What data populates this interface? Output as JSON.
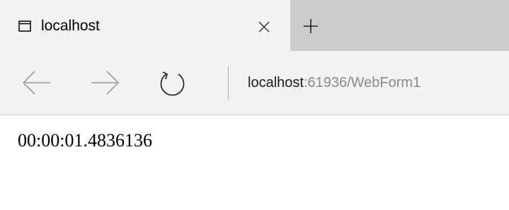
{
  "tab": {
    "icon": "page-icon",
    "title": "localhost",
    "close_icon": "close-icon"
  },
  "new_tab_icon": "plus-icon",
  "nav": {
    "back_icon": "back-arrow-icon",
    "forward_icon": "forward-arrow-icon",
    "refresh_icon": "refresh-icon"
  },
  "address": {
    "host": "localhost",
    "path": ":61936/WebForm1"
  },
  "page": {
    "text": "00:00:01.4836136"
  },
  "colors": {
    "tab_active_bg": "#f2f2f2",
    "tabbar_bg": "#cccccc",
    "nav_icon": "#9a9a9a",
    "address_path": "#8a8a8a"
  }
}
